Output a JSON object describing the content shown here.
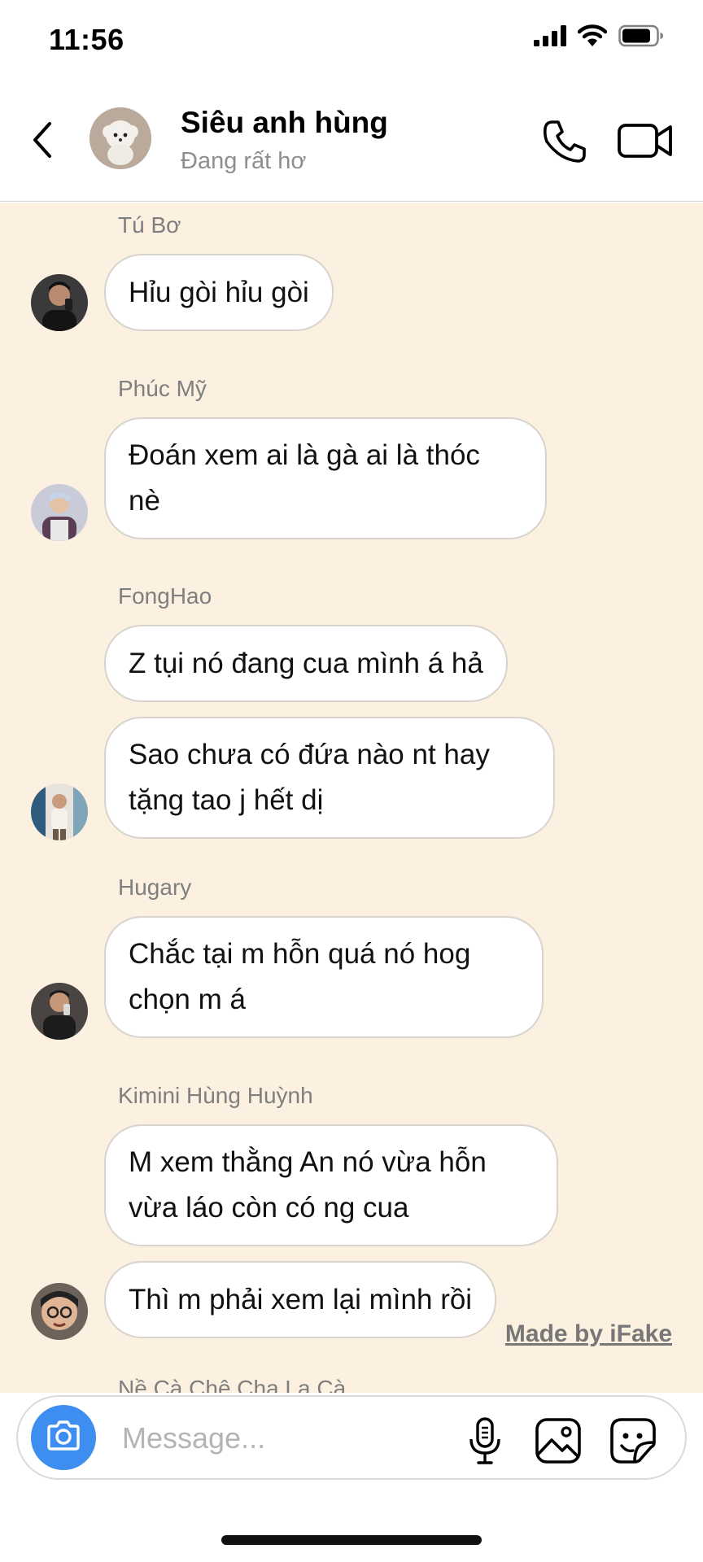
{
  "status_bar": {
    "time": "11:56"
  },
  "header": {
    "group_name": "Siêu anh hùng",
    "status": "Đang rất hơ"
  },
  "messages": [
    {
      "sender": "Tú Bơ",
      "texts": [
        "Hỉu gòi hỉu gòi"
      ]
    },
    {
      "sender": "Phúc Mỹ",
      "texts": [
        "Đoán xem ai là gà ai là thóc\nnè"
      ]
    },
    {
      "sender": "FongHao",
      "texts": [
        "Z tụi nó đang cua mình á hả",
        "Sao chưa có đứa nào nt hay\ntặng tao j hết dị"
      ]
    },
    {
      "sender": "Hugary",
      "texts": [
        "Chắc tại m hỗn quá nó hog\nchọn m á"
      ]
    },
    {
      "sender": "Kimini Hùng Huỳnh",
      "texts": [
        "M xem thằng An nó vừa hỗn\nvừa láo còn có ng cua",
        "Thì m phải xem lại mình rồi"
      ]
    },
    {
      "sender": "Nề Cà Chê Cha La Cà",
      "texts": []
    }
  ],
  "watermark": "Made by iFake",
  "composer": {
    "placeholder": "Message..."
  },
  "colors": {
    "chat_background": "#fcf0e1",
    "bubble_background": "#ffffff",
    "camera_button": "#3d8ef0"
  },
  "icons": {
    "back": "chevron-left-icon",
    "call": "phone-icon",
    "video": "video-camera-icon",
    "camera": "camera-icon",
    "mic": "microphone-icon",
    "gallery": "image-icon",
    "sticker": "sticker-icon"
  }
}
